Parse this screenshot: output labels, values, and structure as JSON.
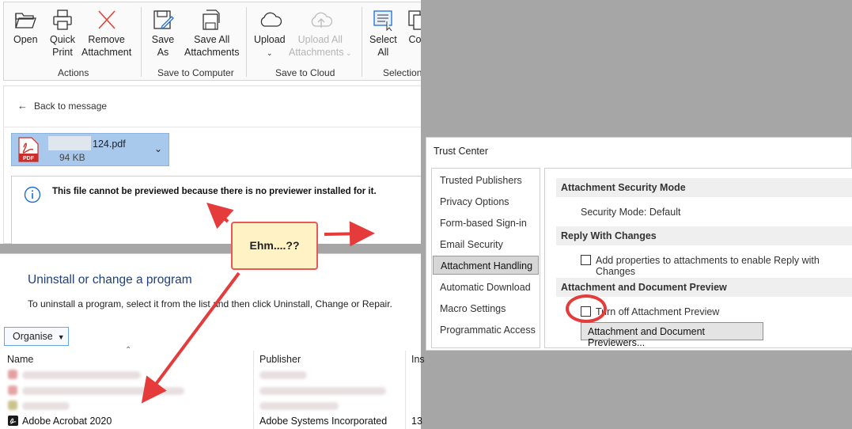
{
  "ribbon": {
    "buttons": {
      "open": "Open",
      "quick_print_1": "Quick",
      "quick_print_2": "Print",
      "remove_1": "Remove",
      "remove_2": "Attachment",
      "save_as_1": "Save",
      "save_as_2": "As",
      "save_all_1": "Save All",
      "save_all_2": "Attachments",
      "upload": "Upload",
      "upload_all_1": "Upload All",
      "upload_all_2": "Attachments",
      "select_all_1": "Select",
      "select_all_2": "All",
      "copy": "Cop"
    },
    "groups": {
      "actions": "Actions",
      "save_computer": "Save to Computer",
      "save_cloud": "Save to Cloud",
      "selection": "Selection"
    }
  },
  "outlook": {
    "back_label": "Back to message",
    "attachment": {
      "name": "124.pdf",
      "size": "94 KB",
      "icon_label": "PDF"
    },
    "preview_message": "This file cannot be previewed because there is no previewer installed for it."
  },
  "control_panel": {
    "title": "Uninstall or change a program",
    "subtitle": "To uninstall a program, select it from the list and then click Uninstall, Change or Repair.",
    "organise_label": "Organise",
    "columns": {
      "name": "Name",
      "publisher": "Publisher",
      "installed": "Ins"
    },
    "visible_row": {
      "name": "Adobe Acrobat 2020",
      "publisher": "Adobe Systems Incorporated",
      "installed": "13"
    }
  },
  "trust_center": {
    "title": "Trust Center",
    "nav": [
      "Trusted Publishers",
      "Privacy Options",
      "Form-based Sign-in",
      "Email Security",
      "Attachment Handling",
      "Automatic Download",
      "Macro Settings",
      "Programmatic Access"
    ],
    "selected_nav": "Attachment Handling",
    "sections": {
      "security_mode_header": "Attachment Security Mode",
      "security_mode_value": "Security Mode: Default",
      "reply_header": "Reply With Changes",
      "reply_option": "Add properties to attachments to enable Reply with Changes",
      "preview_header": "Attachment and Document Preview",
      "turn_off_option": "Turn off Attachment Preview",
      "previewers_button": "Attachment and Document Previewers..."
    }
  },
  "annotation": {
    "callout_text": "Ehm....??",
    "accent_color": "#e63b3b"
  }
}
